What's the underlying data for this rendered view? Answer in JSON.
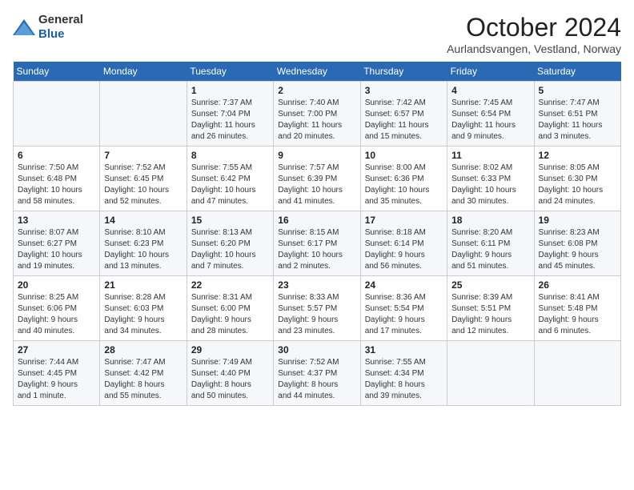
{
  "header": {
    "title": "October 2024",
    "subtitle": "Aurlandsvangen, Vestland, Norway",
    "logo_general": "General",
    "logo_blue": "Blue"
  },
  "days_of_week": [
    "Sunday",
    "Monday",
    "Tuesday",
    "Wednesday",
    "Thursday",
    "Friday",
    "Saturday"
  ],
  "weeks": [
    [
      {
        "day": "",
        "detail": ""
      },
      {
        "day": "",
        "detail": ""
      },
      {
        "day": "1",
        "detail": "Sunrise: 7:37 AM\nSunset: 7:04 PM\nDaylight: 11 hours\nand 26 minutes."
      },
      {
        "day": "2",
        "detail": "Sunrise: 7:40 AM\nSunset: 7:00 PM\nDaylight: 11 hours\nand 20 minutes."
      },
      {
        "day": "3",
        "detail": "Sunrise: 7:42 AM\nSunset: 6:57 PM\nDaylight: 11 hours\nand 15 minutes."
      },
      {
        "day": "4",
        "detail": "Sunrise: 7:45 AM\nSunset: 6:54 PM\nDaylight: 11 hours\nand 9 minutes."
      },
      {
        "day": "5",
        "detail": "Sunrise: 7:47 AM\nSunset: 6:51 PM\nDaylight: 11 hours\nand 3 minutes."
      }
    ],
    [
      {
        "day": "6",
        "detail": "Sunrise: 7:50 AM\nSunset: 6:48 PM\nDaylight: 10 hours\nand 58 minutes."
      },
      {
        "day": "7",
        "detail": "Sunrise: 7:52 AM\nSunset: 6:45 PM\nDaylight: 10 hours\nand 52 minutes."
      },
      {
        "day": "8",
        "detail": "Sunrise: 7:55 AM\nSunset: 6:42 PM\nDaylight: 10 hours\nand 47 minutes."
      },
      {
        "day": "9",
        "detail": "Sunrise: 7:57 AM\nSunset: 6:39 PM\nDaylight: 10 hours\nand 41 minutes."
      },
      {
        "day": "10",
        "detail": "Sunrise: 8:00 AM\nSunset: 6:36 PM\nDaylight: 10 hours\nand 35 minutes."
      },
      {
        "day": "11",
        "detail": "Sunrise: 8:02 AM\nSunset: 6:33 PM\nDaylight: 10 hours\nand 30 minutes."
      },
      {
        "day": "12",
        "detail": "Sunrise: 8:05 AM\nSunset: 6:30 PM\nDaylight: 10 hours\nand 24 minutes."
      }
    ],
    [
      {
        "day": "13",
        "detail": "Sunrise: 8:07 AM\nSunset: 6:27 PM\nDaylight: 10 hours\nand 19 minutes."
      },
      {
        "day": "14",
        "detail": "Sunrise: 8:10 AM\nSunset: 6:23 PM\nDaylight: 10 hours\nand 13 minutes."
      },
      {
        "day": "15",
        "detail": "Sunrise: 8:13 AM\nSunset: 6:20 PM\nDaylight: 10 hours\nand 7 minutes."
      },
      {
        "day": "16",
        "detail": "Sunrise: 8:15 AM\nSunset: 6:17 PM\nDaylight: 10 hours\nand 2 minutes."
      },
      {
        "day": "17",
        "detail": "Sunrise: 8:18 AM\nSunset: 6:14 PM\nDaylight: 9 hours\nand 56 minutes."
      },
      {
        "day": "18",
        "detail": "Sunrise: 8:20 AM\nSunset: 6:11 PM\nDaylight: 9 hours\nand 51 minutes."
      },
      {
        "day": "19",
        "detail": "Sunrise: 8:23 AM\nSunset: 6:08 PM\nDaylight: 9 hours\nand 45 minutes."
      }
    ],
    [
      {
        "day": "20",
        "detail": "Sunrise: 8:25 AM\nSunset: 6:06 PM\nDaylight: 9 hours\nand 40 minutes."
      },
      {
        "day": "21",
        "detail": "Sunrise: 8:28 AM\nSunset: 6:03 PM\nDaylight: 9 hours\nand 34 minutes."
      },
      {
        "day": "22",
        "detail": "Sunrise: 8:31 AM\nSunset: 6:00 PM\nDaylight: 9 hours\nand 28 minutes."
      },
      {
        "day": "23",
        "detail": "Sunrise: 8:33 AM\nSunset: 5:57 PM\nDaylight: 9 hours\nand 23 minutes."
      },
      {
        "day": "24",
        "detail": "Sunrise: 8:36 AM\nSunset: 5:54 PM\nDaylight: 9 hours\nand 17 minutes."
      },
      {
        "day": "25",
        "detail": "Sunrise: 8:39 AM\nSunset: 5:51 PM\nDaylight: 9 hours\nand 12 minutes."
      },
      {
        "day": "26",
        "detail": "Sunrise: 8:41 AM\nSunset: 5:48 PM\nDaylight: 9 hours\nand 6 minutes."
      }
    ],
    [
      {
        "day": "27",
        "detail": "Sunrise: 7:44 AM\nSunset: 4:45 PM\nDaylight: 9 hours\nand 1 minute."
      },
      {
        "day": "28",
        "detail": "Sunrise: 7:47 AM\nSunset: 4:42 PM\nDaylight: 8 hours\nand 55 minutes."
      },
      {
        "day": "29",
        "detail": "Sunrise: 7:49 AM\nSunset: 4:40 PM\nDaylight: 8 hours\nand 50 minutes."
      },
      {
        "day": "30",
        "detail": "Sunrise: 7:52 AM\nSunset: 4:37 PM\nDaylight: 8 hours\nand 44 minutes."
      },
      {
        "day": "31",
        "detail": "Sunrise: 7:55 AM\nSunset: 4:34 PM\nDaylight: 8 hours\nand 39 minutes."
      },
      {
        "day": "",
        "detail": ""
      },
      {
        "day": "",
        "detail": ""
      }
    ]
  ]
}
